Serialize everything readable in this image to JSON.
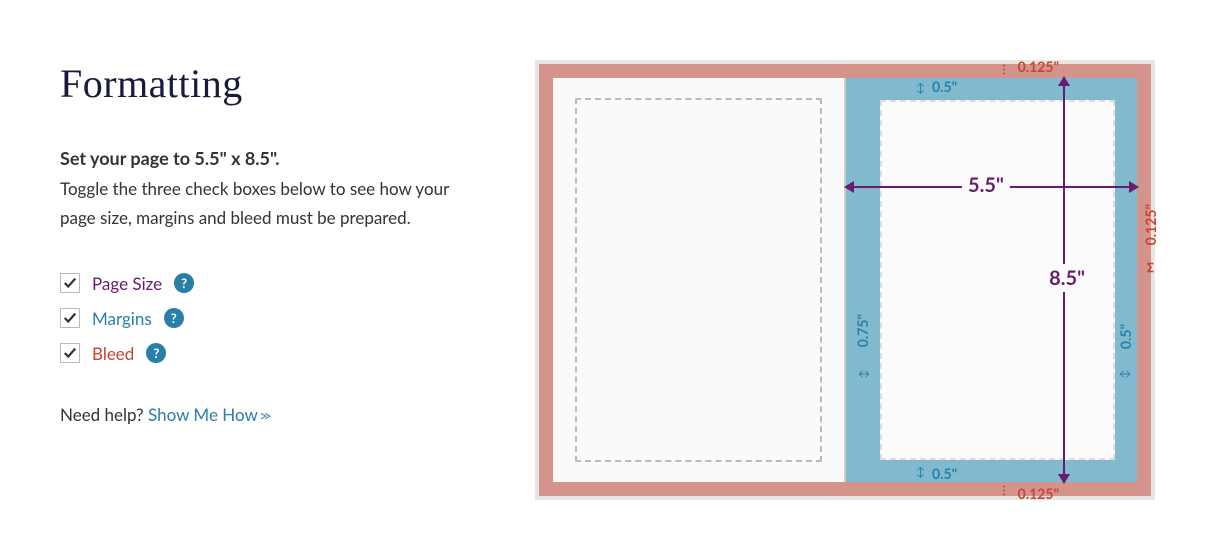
{
  "heading": "Formatting",
  "instruction_bold": "Set your page to 5.5\" x 8.5\".",
  "instruction_text": "Toggle the three check boxes below to see how your page size, margins and bleed must be prepared.",
  "checkboxes": {
    "page_size": {
      "label": "Page Size",
      "checked": true
    },
    "margins": {
      "label": "Margins",
      "checked": true
    },
    "bleed": {
      "label": "Bleed",
      "checked": true
    }
  },
  "help_glyph": "?",
  "need_help_prefix": "Need help? ",
  "show_me_how": "Show Me How",
  "diagram": {
    "width_label": "5.5\"",
    "height_label": "8.5\"",
    "margin_top": "0.5\"",
    "margin_bottom": "0.5\"",
    "margin_outer": "0.5\"",
    "margin_inner": "0.75\"",
    "bleed_top": "0.125\"",
    "bleed_bottom": "0.125\"",
    "bleed_outer": "0.125\""
  }
}
